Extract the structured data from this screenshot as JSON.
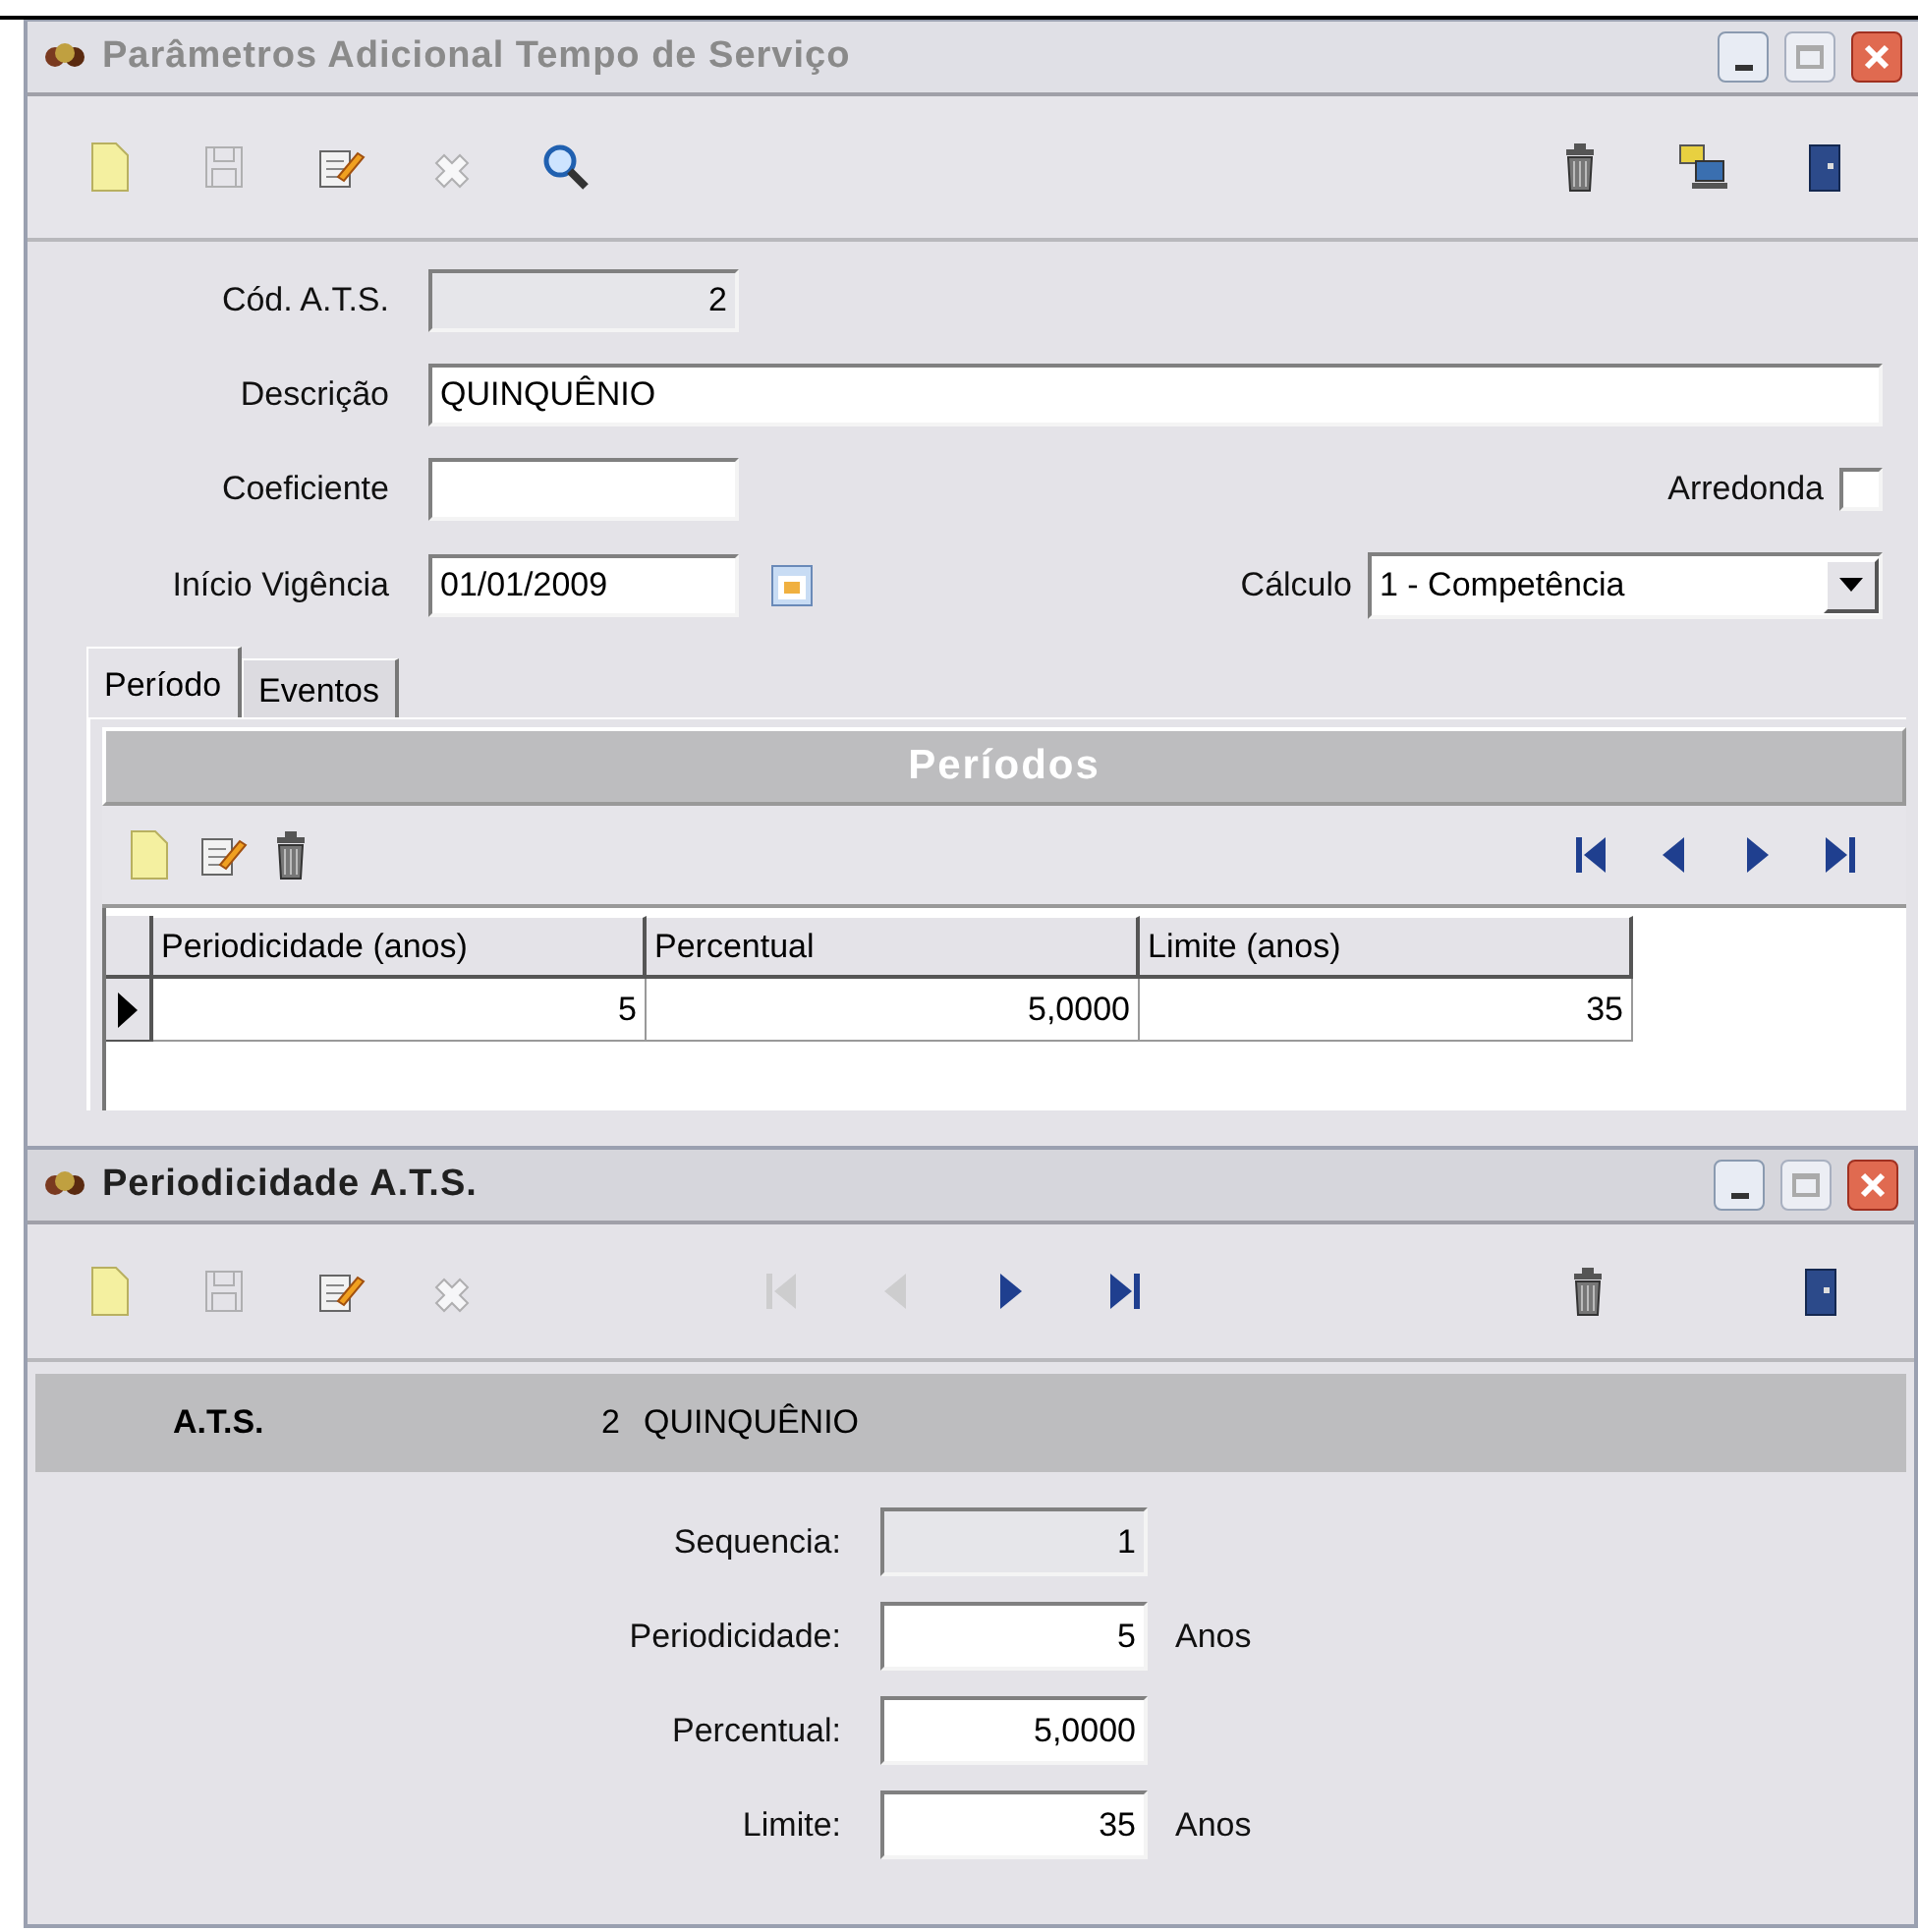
{
  "main_window": {
    "title": "Parâmetros Adicional Tempo de Serviço",
    "active": false,
    "toolbar_left": [
      {
        "kind": "new",
        "disabled": false
      },
      {
        "kind": "save",
        "disabled": true
      },
      {
        "kind": "edit",
        "disabled": false
      },
      {
        "kind": "cancel",
        "disabled": true
      },
      {
        "kind": "search",
        "disabled": false
      }
    ],
    "toolbar_right": [
      {
        "kind": "delete",
        "disabled": false
      },
      {
        "kind": "network",
        "disabled": false
      },
      {
        "kind": "exit",
        "disabled": false
      }
    ],
    "cod": {
      "label": "Cód. A.T.S.",
      "value": "2",
      "readonly": true
    },
    "descricao": {
      "label": "Descrição",
      "value": "QUINQUÊNIO"
    },
    "coeficiente": {
      "label": "Coeficiente"
    },
    "arredonda": {
      "label": "Arredonda",
      "checked": false
    },
    "inicio": {
      "label": "Início Vigência",
      "value": "01/01/2009"
    },
    "calculo": {
      "label": "Cálculo",
      "value": "1 - Competência"
    },
    "tabs": [
      {
        "label": "Período",
        "selected": true
      },
      {
        "label": "Eventos",
        "selected": false
      }
    ],
    "periodos": {
      "title": "Períodos",
      "toolbar": [
        {
          "kind": "new",
          "disabled": false
        },
        {
          "kind": "edit",
          "disabled": false
        },
        {
          "kind": "delete",
          "disabled": false
        }
      ],
      "nav": [
        {
          "kind": "first",
          "disabled": false
        },
        {
          "kind": "prev",
          "disabled": false
        },
        {
          "kind": "next",
          "disabled": false
        },
        {
          "kind": "last",
          "disabled": false
        }
      ],
      "columns": [
        "Periodicidade (anos)",
        "Percentual",
        "Limite (anos)"
      ],
      "rows": [
        {
          "current": true,
          "cells": [
            "5",
            "5,0000",
            "35"
          ]
        }
      ]
    }
  },
  "detail_window": {
    "title": "Periodicidade A.T.S.",
    "active": true,
    "toolbar_left": [
      {
        "kind": "new",
        "disabled": false
      },
      {
        "kind": "save",
        "disabled": true
      },
      {
        "kind": "edit",
        "disabled": false
      },
      {
        "kind": "cancel",
        "disabled": true
      }
    ],
    "nav": [
      {
        "kind": "first",
        "disabled": true
      },
      {
        "kind": "prev",
        "disabled": true
      },
      {
        "kind": "next",
        "disabled": false
      },
      {
        "kind": "last",
        "disabled": false
      }
    ],
    "toolbar_right": [
      {
        "kind": "delete",
        "disabled": false
      },
      {
        "kind": "exit",
        "disabled": false
      }
    ],
    "header": {
      "label": "A.T.S.",
      "code": "2",
      "name": "QUINQUÊNIO"
    },
    "fields": [
      {
        "label": "Sequencia:",
        "value": "1",
        "readonly": true
      },
      {
        "label": "Periodicidade:",
        "value": "5",
        "readonly": false,
        "unit": "Anos"
      },
      {
        "label": "Percentual:",
        "value": "5,0000",
        "readonly": false
      },
      {
        "label": "Limite:",
        "value": "35",
        "readonly": false,
        "unit": "Anos"
      }
    ]
  }
}
